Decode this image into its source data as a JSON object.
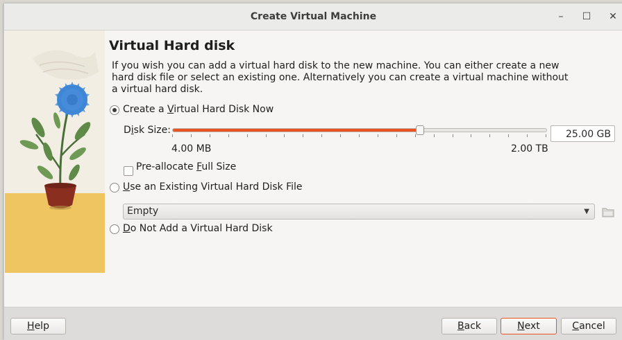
{
  "window": {
    "title": "Create Virtual Machine",
    "controls": {
      "minimize": "–",
      "maximize": "☐",
      "close": "✕"
    }
  },
  "page": {
    "heading": "Virtual Hard disk",
    "description": "If you wish you can add a virtual hard disk to the new machine. You can either create a new hard disk file or select an existing one. Alternatively you can create a virtual machine without a virtual hard disk."
  },
  "options": {
    "create_new": {
      "label_pre": "Create a ",
      "label_u": "V",
      "label_post": "irtual Hard Disk Now",
      "selected": true
    },
    "use_existing": {
      "label_pre": "",
      "label_u": "U",
      "label_post": "se an Existing Virtual Hard Disk File",
      "selected": false
    },
    "no_disk": {
      "label_pre": "",
      "label_u": "D",
      "label_post": "o Not Add a Virtual Hard Disk",
      "selected": false
    }
  },
  "disk_size": {
    "label_pre": "D",
    "label_u": "i",
    "label_post": "sk Size:",
    "value": "25.00 GB",
    "min_label": "4.00 MB",
    "max_label": "2.00 TB",
    "slider_fraction": 0.66
  },
  "preallocate": {
    "label_pre": "Pre-allocate ",
    "label_u": "F",
    "label_post": "ull Size",
    "checked": false
  },
  "existing_file": {
    "selected": "Empty"
  },
  "buttons": {
    "help": {
      "label_u": "H",
      "label_post": "elp"
    },
    "back": {
      "label_u": "B",
      "label_post": "ack"
    },
    "next": {
      "label_u": "N",
      "label_post": "ext"
    },
    "cancel": {
      "label_u": "C",
      "label_post": "ancel"
    }
  },
  "colors": {
    "accent": "#e95420",
    "wall_light": "#f3eee4",
    "floor": "#efc561",
    "pot": "#8a2e20",
    "flower": "#3f86d6"
  },
  "icons": [
    "minimize-icon",
    "maximize-icon",
    "close-icon",
    "folder-icon",
    "chevron-down-icon"
  ]
}
